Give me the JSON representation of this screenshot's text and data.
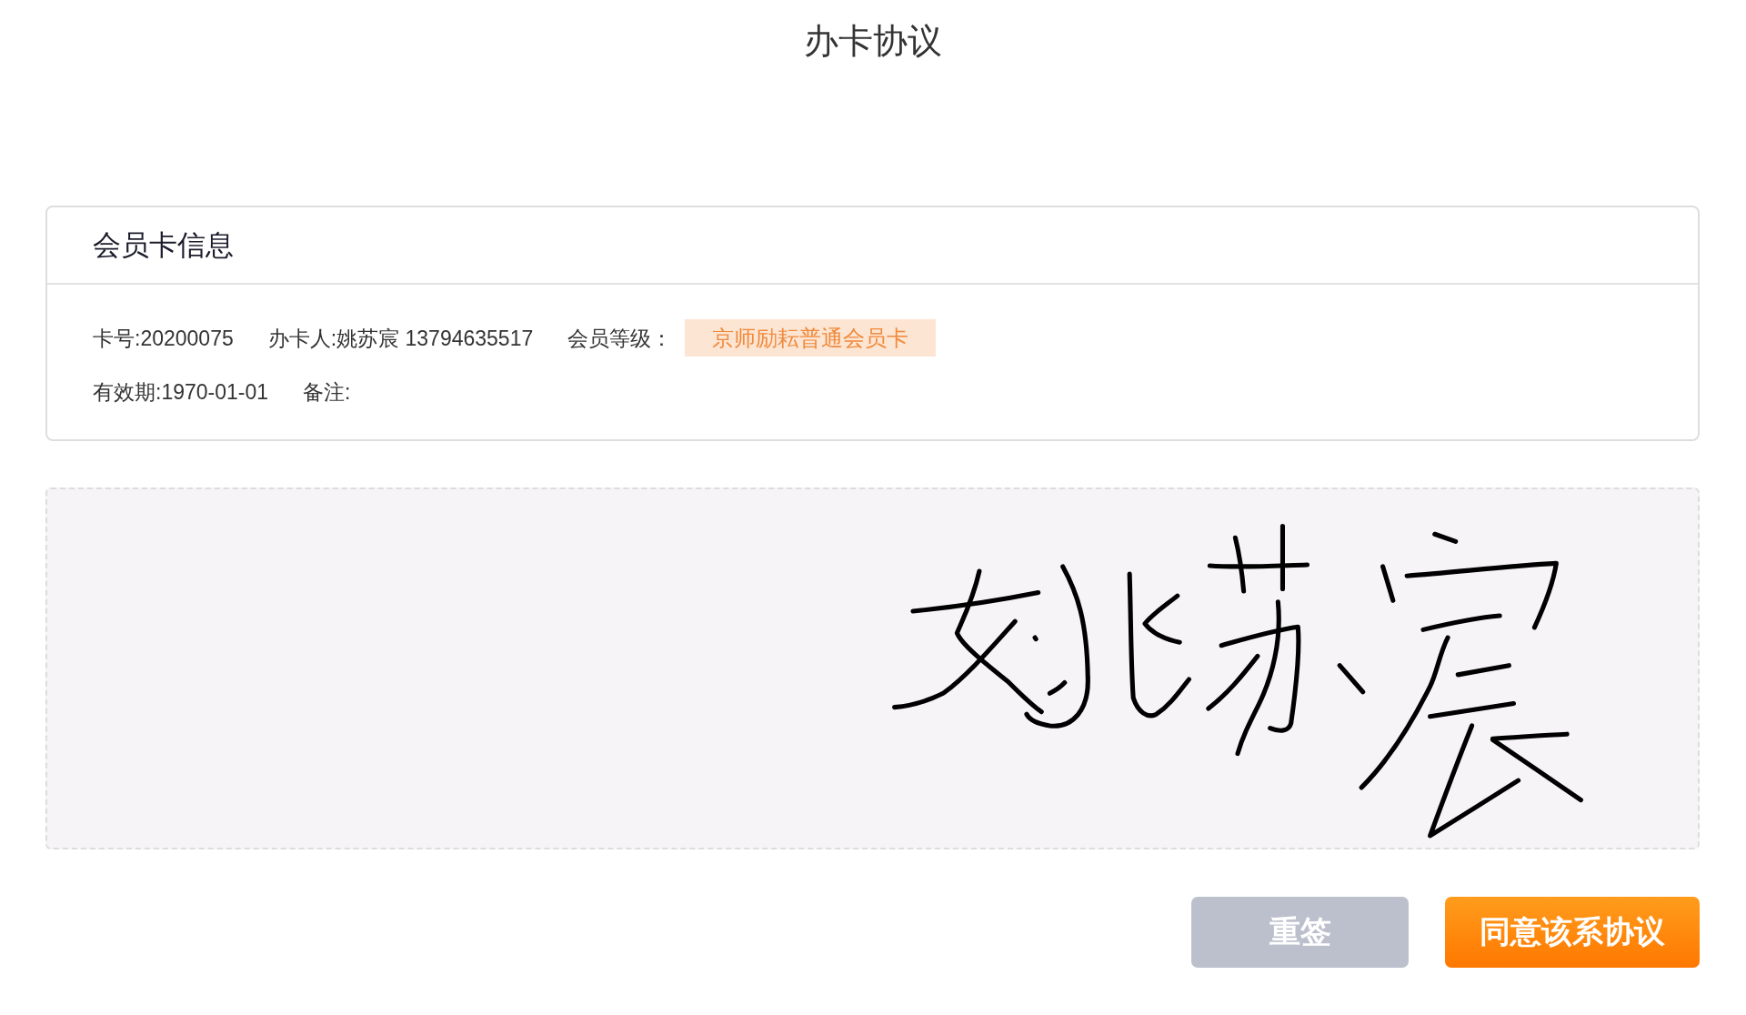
{
  "page": {
    "title": "办卡协议"
  },
  "member_card": {
    "title": "会员卡信息",
    "rows": [
      {
        "fields": [
          {
            "text": "卡号:20200075"
          },
          {
            "text": "办卡人:姚苏宸 13794635517"
          },
          {
            "text": "会员等级：",
            "badge": "京师励耘普通会员卡"
          }
        ]
      },
      {
        "fields": [
          {
            "text": "有效期:1970-01-01"
          },
          {
            "text": "备注:"
          }
        ]
      }
    ]
  },
  "signature_pad": {
    "signed": true
  },
  "buttons": [
    {
      "kind": "secondary",
      "label": "重签"
    },
    {
      "kind": "primary",
      "label": "同意该系协议"
    }
  ]
}
